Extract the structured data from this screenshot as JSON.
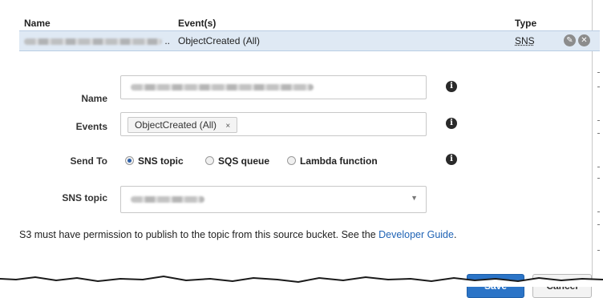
{
  "table": {
    "headers": {
      "name": "Name",
      "events": "Event(s)",
      "type": "Type"
    },
    "row": {
      "name_suffix": "..",
      "events": "ObjectCreated (All)",
      "type": "SNS"
    }
  },
  "form": {
    "name": {
      "label": "Name"
    },
    "events": {
      "label": "Events",
      "token": "ObjectCreated (All)",
      "token_remove": "×"
    },
    "send_to": {
      "label": "Send To",
      "options": [
        {
          "label": "SNS topic",
          "selected": true
        },
        {
          "label": "SQS queue",
          "selected": false
        },
        {
          "label": "Lambda function",
          "selected": false
        }
      ]
    },
    "sns_topic": {
      "label": "SNS topic"
    }
  },
  "notice": {
    "text": "S3 must have permission to publish to the topic from this source bucket. See the ",
    "link": "Developer Guide",
    "end": "."
  },
  "actions": {
    "save": "Save",
    "cancel": "Cancel"
  },
  "icons": {
    "edit": "pencil-icon",
    "remove": "close-circle-icon",
    "info": "info-icon",
    "dropdown": "chevron-down-icon"
  },
  "colors": {
    "accent": "#2b74c7",
    "row_highlight": "#dfe9f4",
    "link": "#1f63b5"
  }
}
